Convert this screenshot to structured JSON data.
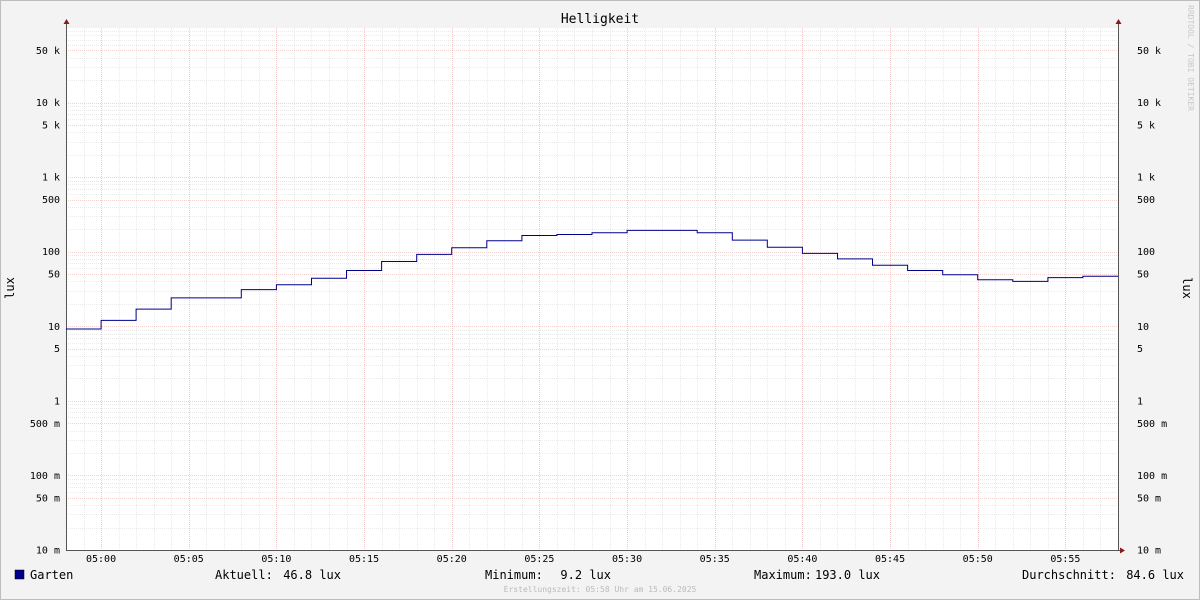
{
  "chart_data": {
    "type": "line",
    "title": "Helligkeit",
    "ylabel": "lux",
    "y_scale": "log",
    "ylim": [
      0.01,
      100000
    ],
    "y_ticks": [
      {
        "value": 0.01,
        "label": "10 m"
      },
      {
        "value": 0.05,
        "label": "50 m"
      },
      {
        "value": 0.1,
        "label": "100 m"
      },
      {
        "value": 0.5,
        "label": "500 m"
      },
      {
        "value": 1,
        "label": "1"
      },
      {
        "value": 5,
        "label": "5"
      },
      {
        "value": 10,
        "label": "10"
      },
      {
        "value": 50,
        "label": "50"
      },
      {
        "value": 100,
        "label": "100"
      },
      {
        "value": 500,
        "label": "500"
      },
      {
        "value": 1000,
        "label": "1 k"
      },
      {
        "value": 5000,
        "label": "5 k"
      },
      {
        "value": 10000,
        "label": "10 k"
      },
      {
        "value": 50000,
        "label": "50 k"
      }
    ],
    "xlim": [
      "04:58",
      "05:58"
    ],
    "x_ticks": [
      "05:00",
      "05:05",
      "05:10",
      "05:15",
      "05:20",
      "05:25",
      "05:30",
      "05:35",
      "05:40",
      "05:45",
      "05:50",
      "05:55"
    ],
    "grid": true,
    "series": [
      {
        "name": "Garten",
        "color": "#00008b",
        "x": [
          "04:58",
          "05:00",
          "05:02",
          "05:04",
          "05:08",
          "05:10",
          "05:12",
          "05:14",
          "05:16",
          "05:18",
          "05:20",
          "05:22",
          "05:24",
          "05:26",
          "05:28",
          "05:30",
          "05:34",
          "05:36",
          "05:38",
          "05:40",
          "05:42",
          "05:44",
          "05:46",
          "05:48",
          "05:50",
          "05:52",
          "05:54",
          "05:56"
        ],
        "values": [
          9.2,
          12,
          17,
          24,
          31,
          36,
          44,
          56,
          74,
          92,
          113,
          140,
          165,
          170,
          180,
          193,
          180,
          143,
          115,
          95,
          80,
          66,
          56,
          49,
          42,
          40,
          45,
          46.8
        ]
      }
    ],
    "end_x": "05:58"
  },
  "legend": {
    "series_name": "Garten",
    "current_label": "Aktuell:",
    "current_value": "46.8 lux",
    "min_label": "Minimum:",
    "min_value": "9.2 lux",
    "max_label": "Maximum:",
    "max_value": "193.0 lux",
    "avg_label": "Durchschnitt:",
    "avg_value": "84.6 lux"
  },
  "footer": "Erstellungszeit: 05:58 Uhr am 15.06.2025",
  "watermark": "RRDTOOL / TOBI OETIKER"
}
